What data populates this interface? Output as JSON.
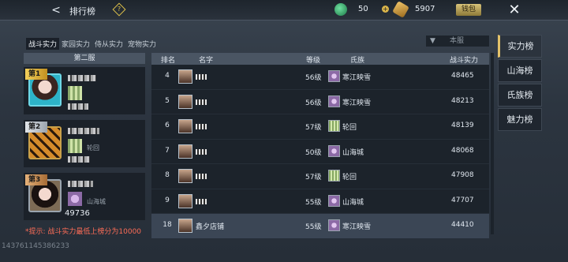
{
  "topbar": {
    "title": "排行榜",
    "help_symbol": "?",
    "jade_value": "50",
    "gold_value": "5907",
    "qianzhuang_label": "钱包",
    "back_symbol": "<",
    "close_symbol": "✕",
    "plus_symbol": "+"
  },
  "tabs": [
    "战斗实力",
    "家园实力",
    "侍从实力",
    "宠物实力"
  ],
  "server_select": {
    "value": "本服",
    "chevron": "▼"
  },
  "top3": {
    "header": "第二服",
    "entries": [
      {
        "badge": "第1",
        "guild": "",
        "power": ""
      },
      {
        "badge": "第2",
        "guild": "轮回",
        "power": ""
      },
      {
        "badge": "第3",
        "guild": "山海城",
        "power": "49736"
      }
    ]
  },
  "hint": "*提示: 战斗实力最低上榜分为10000",
  "uid": "143761145386233",
  "table": {
    "headers": {
      "rank": "排名",
      "name": "名字",
      "level": "等级",
      "guild": "氏族",
      "power": "战斗实力"
    },
    "rows": [
      {
        "rank": "4",
        "name": "",
        "level": "56级",
        "guild": "寒江映雪",
        "guild_color": "purple",
        "power": "48465"
      },
      {
        "rank": "5",
        "name": "",
        "level": "56级",
        "guild": "寒江映雪",
        "guild_color": "purple",
        "power": "48213"
      },
      {
        "rank": "6",
        "name": "",
        "level": "57级",
        "guild": "轮回",
        "guild_color": "green",
        "power": "48139"
      },
      {
        "rank": "7",
        "name": "",
        "level": "50级",
        "guild": "山海城",
        "guild_color": "purple",
        "power": "48068"
      },
      {
        "rank": "8",
        "name": "",
        "level": "57级",
        "guild": "轮回",
        "guild_color": "green",
        "power": "47908"
      },
      {
        "rank": "9",
        "name": "",
        "level": "55级",
        "guild": "山海城",
        "guild_color": "purple",
        "power": "47707"
      },
      {
        "rank": "18",
        "name": "鑫夕店铺",
        "level": "55级",
        "guild": "寒江映雪",
        "guild_color": "purple",
        "power": "44410",
        "highlight": true
      }
    ]
  },
  "boards": [
    "实力榜",
    "山海榜",
    "氏族榜",
    "魅力榜"
  ]
}
